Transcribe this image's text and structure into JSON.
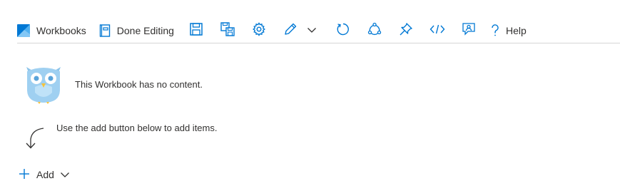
{
  "toolbar": {
    "workbooks_label": "Workbooks",
    "done_editing_label": "Done Editing",
    "help_label": "Help",
    "icons": [
      "workbooks-logo-icon",
      "done-editing-icon",
      "save-icon",
      "save-as-icon",
      "settings-icon",
      "edit-icon",
      "chevron-down-icon",
      "refresh-icon",
      "share-icon",
      "pin-icon",
      "code-icon",
      "feedback-icon",
      "help-icon"
    ],
    "accent_color": "#0078d4"
  },
  "empty_state": {
    "no_content_message": "This Workbook has no content.",
    "hint_message": "Use the add button below to add items."
  },
  "add": {
    "label": "Add"
  }
}
